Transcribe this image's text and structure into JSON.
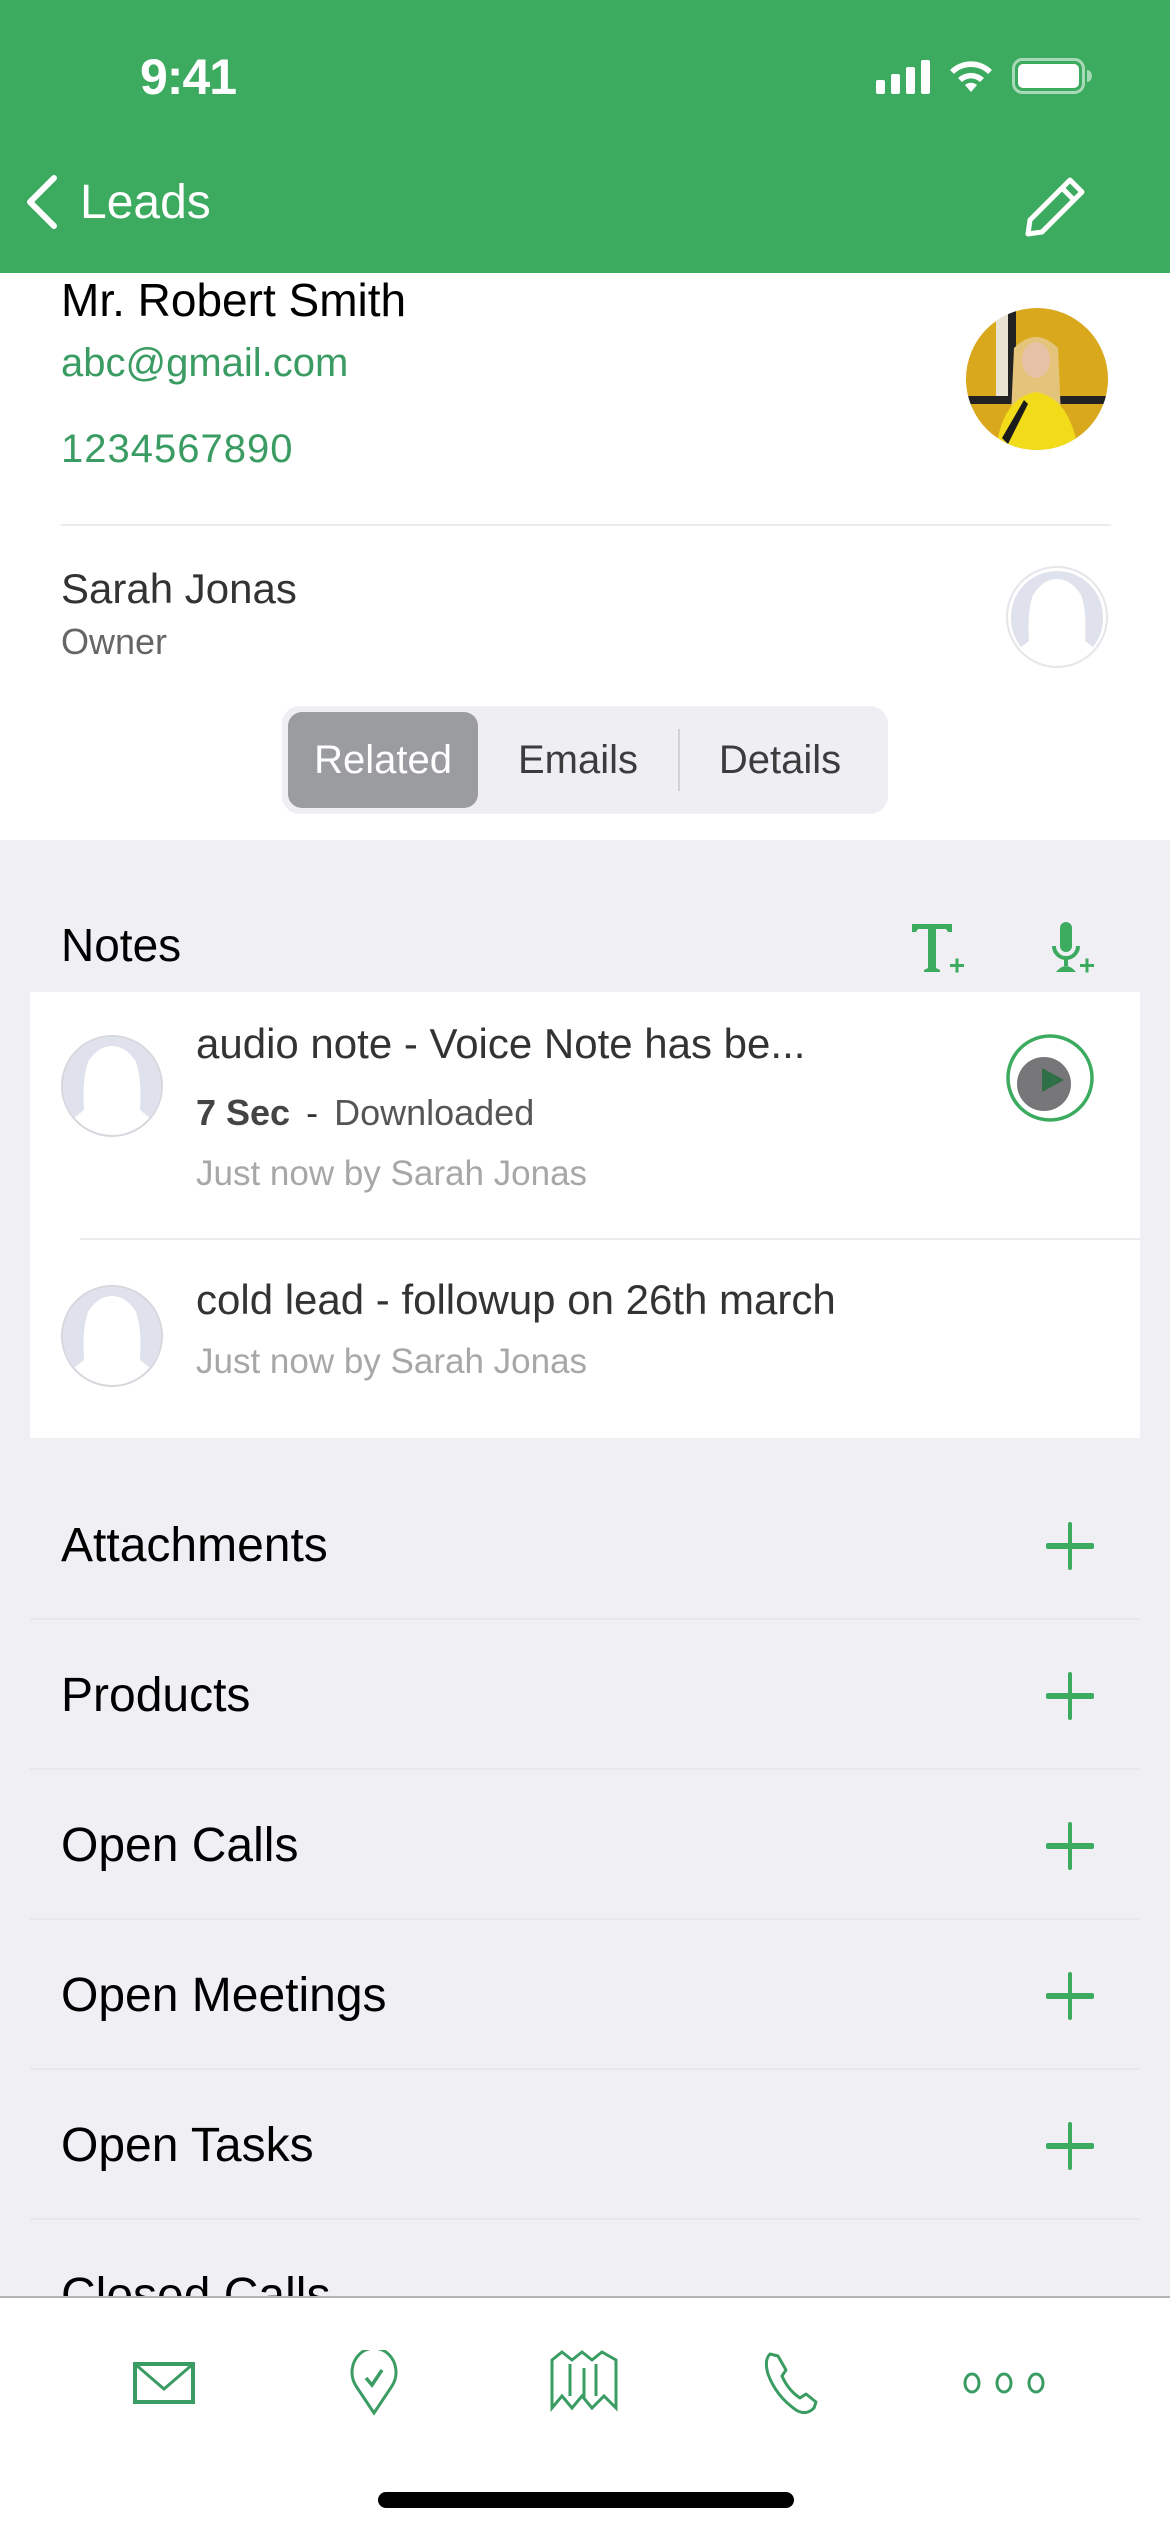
{
  "status_bar": {
    "time": "9:41"
  },
  "nav": {
    "back_label": "Leads"
  },
  "contact": {
    "name": "Mr. Robert Smith",
    "email": "abc@gmail.com",
    "phone": "1234567890"
  },
  "owner": {
    "name": "Sarah Jonas",
    "label": "Owner"
  },
  "tabs": [
    {
      "label": "Related",
      "active": true
    },
    {
      "label": "Emails",
      "active": false
    },
    {
      "label": "Details",
      "active": false
    }
  ],
  "notes": {
    "title": "Notes",
    "items": [
      {
        "title": "audio note - Voice Note has be...",
        "duration": "7 Sec",
        "separator": "-",
        "status": "Downloaded",
        "byline": "Just now by Sarah Jonas"
      },
      {
        "title": "cold lead - followup on 26th march",
        "byline": "Just now by Sarah Jonas"
      }
    ]
  },
  "sections": [
    {
      "label": "Attachments"
    },
    {
      "label": "Products"
    },
    {
      "label": "Open Calls"
    },
    {
      "label": "Open Meetings"
    },
    {
      "label": "Open Tasks"
    },
    {
      "label": "Closed Calls"
    }
  ],
  "tabbar": {
    "items": [
      {
        "icon": "mail-icon"
      },
      {
        "icon": "location-check-icon"
      },
      {
        "icon": "map-icon"
      },
      {
        "icon": "phone-icon"
      },
      {
        "icon": "more-icon"
      }
    ]
  },
  "colors": {
    "brand": "#3cab5f",
    "link": "#3a9c62",
    "background": "#f0eff4"
  }
}
